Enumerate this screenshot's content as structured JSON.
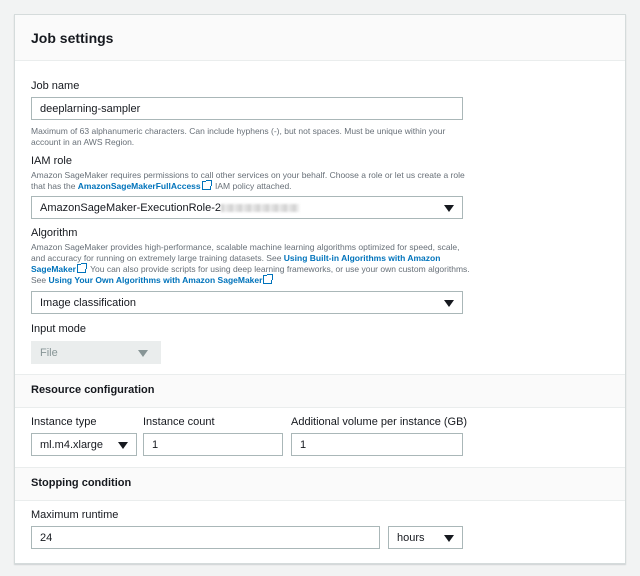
{
  "panel": {
    "title": "Job settings"
  },
  "job_name": {
    "label": "Job name",
    "value": "deeplarning-sampler",
    "hint": "Maximum of 63 alphanumeric characters. Can include hyphens (-), but not spaces. Must be unique within your account in an AWS Region."
  },
  "iam_role": {
    "label": "IAM role",
    "desc_before": "Amazon SageMaker requires permissions to call other services on your behalf. Choose a role or let us create a role that has the",
    "desc_link": "AmazonSageMakerFullAccess",
    "desc_after": "IAM policy attached.",
    "value": "AmazonSageMaker-ExecutionRole-2"
  },
  "algorithm": {
    "label": "Algorithm",
    "desc_before": "Amazon SageMaker provides high-performance, scalable machine learning algorithms optimized for speed, scale, and accuracy for running on extremely large training datasets.  See",
    "link1": "Using Built-in Algorithms with Amazon SageMaker",
    "desc_middle": "You can also provide scripts for using deep learning frameworks, or use your own custom algorithms.  See",
    "link2": "Using Your Own Algorithms with Amazon SageMaker",
    "value": "Image classification"
  },
  "input_mode": {
    "label": "Input mode",
    "value": "File"
  },
  "resource_configuration": {
    "title": "Resource configuration",
    "instance_type": {
      "label": "Instance type",
      "value": "ml.m4.xlarge"
    },
    "instance_count": {
      "label": "Instance count",
      "value": "1"
    },
    "volume": {
      "label": "Additional volume per instance (GB)",
      "value": "1"
    }
  },
  "stopping_condition": {
    "title": "Stopping condition",
    "max_runtime": {
      "label": "Maximum runtime",
      "value": "24",
      "unit": "hours"
    }
  },
  "icons": {
    "external_link": "external-link-icon",
    "dropdown": "caret-down-icon"
  }
}
